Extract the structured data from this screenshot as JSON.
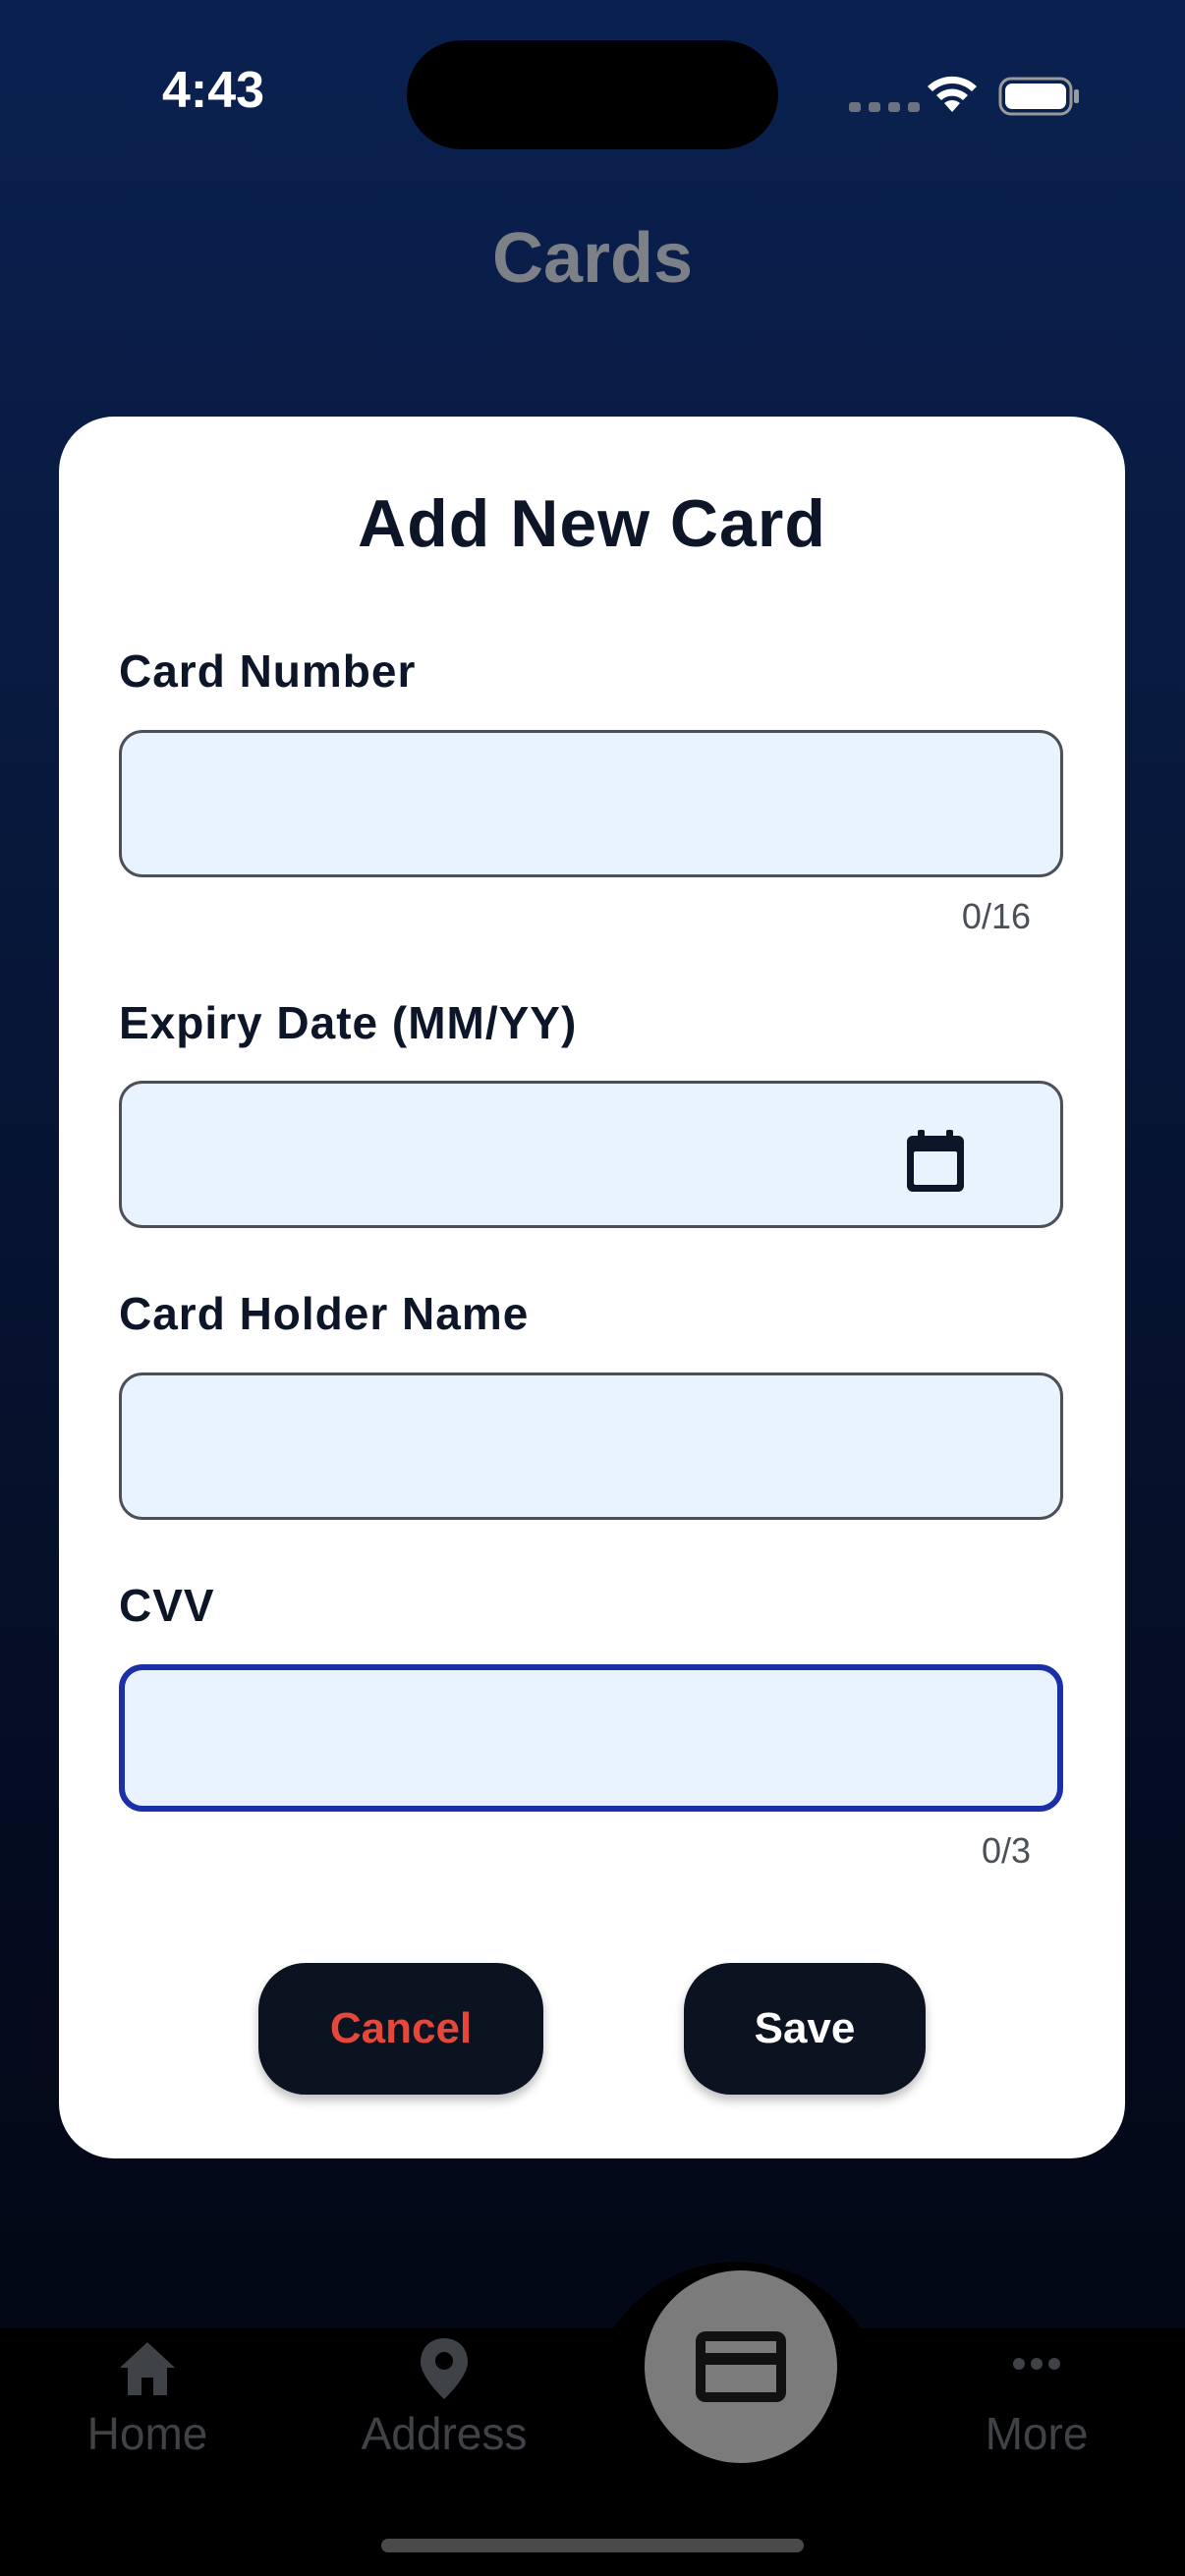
{
  "status_bar": {
    "time": "4:43"
  },
  "header": {
    "title": "Cards"
  },
  "dialog": {
    "title": "Add New Card",
    "fields": {
      "card_number": {
        "label": "Card Number",
        "value": "",
        "counter": "0/16"
      },
      "expiry": {
        "label": "Expiry Date (MM/YY)",
        "value": "",
        "icon": "calendar-icon"
      },
      "holder": {
        "label": "Card Holder Name",
        "value": ""
      },
      "cvv": {
        "label": "CVV",
        "value": "",
        "counter": "0/3"
      }
    },
    "cancel_label": "Cancel",
    "save_label": "Save"
  },
  "bottom_nav": {
    "items": [
      {
        "label": "Home",
        "icon": "home-icon"
      },
      {
        "label": "Address",
        "icon": "location-pin-icon"
      },
      {
        "label": "",
        "icon": "credit-card-icon",
        "active": true
      },
      {
        "label": "More",
        "icon": "more-dots-icon"
      }
    ]
  },
  "colors": {
    "background_top": "#0a2150",
    "background_bottom": "#02060f",
    "input_fill": "#e9f3fe",
    "focus_border": "#1a2fa8",
    "cancel_text": "#e5483a",
    "button_fill": "#0b1220"
  }
}
